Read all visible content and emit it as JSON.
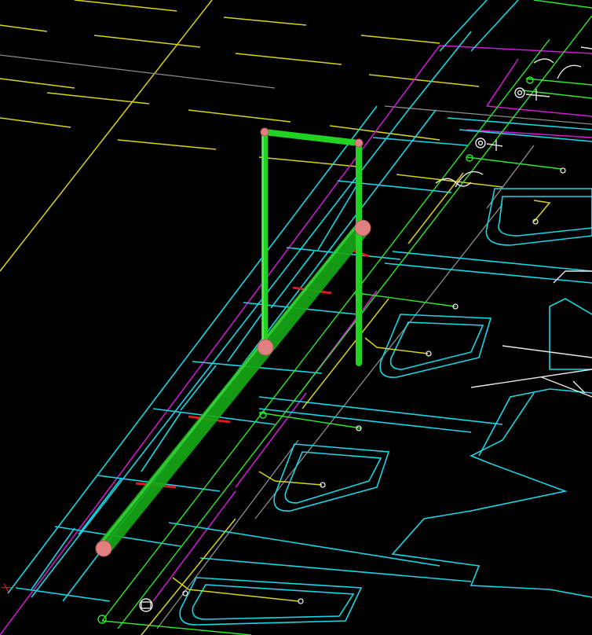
{
  "viewport": {
    "background": "#000000",
    "ucs_axis_label": "X"
  },
  "layers": {
    "cyan": "#19d6e6",
    "yellow": "#d8d21a",
    "green_lines": "#2ee82e",
    "magenta": "#d21ad6",
    "gray": "#8c8c8c",
    "white": "#e6e6e6",
    "red_markers": "#e01a1a",
    "pipe_green": "#22cc22",
    "pipe_node": "#e08080"
  }
}
